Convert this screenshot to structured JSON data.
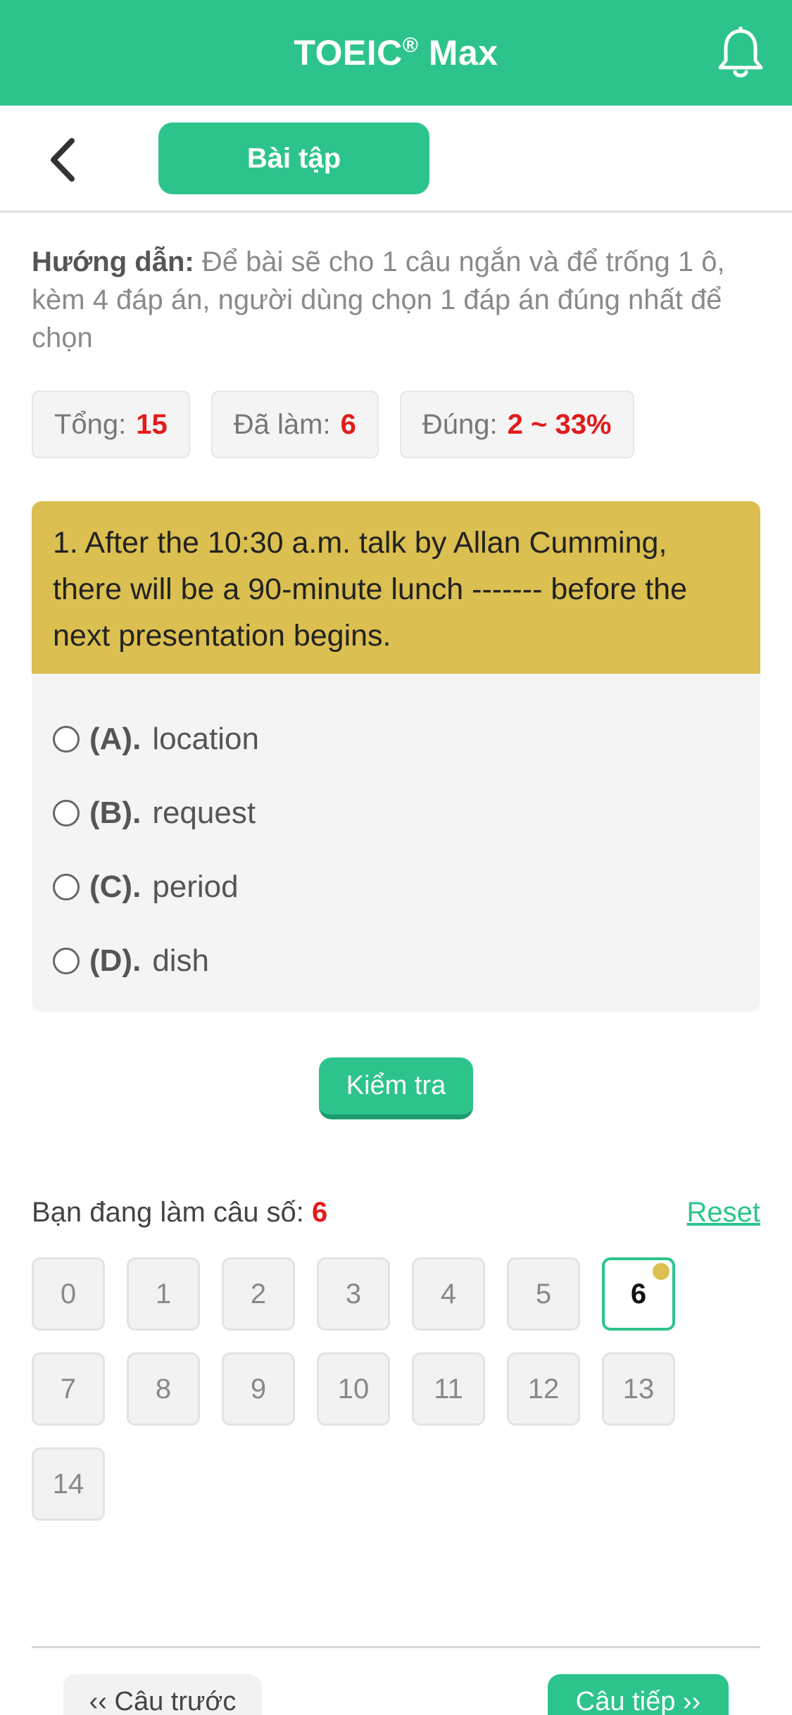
{
  "header": {
    "title": "TOEIC",
    "title_mark": "®",
    "title_suffix": " Max",
    "bell_icon": "bell-icon"
  },
  "subbar": {
    "back_icon": "chevron-left-icon",
    "tab_label": "Bài tập"
  },
  "guide": {
    "label": "Hướng dẫn:",
    "text": " Để bài sẽ cho 1 câu ngắn và để trống 1 ô, kèm 4 đáp án, người dùng chọn 1 đáp án đúng nhất để chọn"
  },
  "stats": {
    "total_label": "Tổng:",
    "total_value": "15",
    "done_label": "Đã làm:",
    "done_value": "6",
    "correct_label": "Đúng:",
    "correct_value": "2 ~ 33%"
  },
  "question": {
    "text": "1. After the 10:30 a.m. talk by Allan Cumming, there will be a 90-minute lunch ------- before the next presentation begins.",
    "options": [
      {
        "letter": "(A).",
        "text": "location"
      },
      {
        "letter": "(B).",
        "text": "request"
      },
      {
        "letter": "(C).",
        "text": "period"
      },
      {
        "letter": "(D).",
        "text": "dish"
      }
    ]
  },
  "check_button": "Kiểm tra",
  "progress": {
    "label": "Bạn đang làm câu số: ",
    "current": "6",
    "reset": "Reset"
  },
  "numbers": [
    "0",
    "1",
    "2",
    "3",
    "4",
    "5",
    "6",
    "7",
    "8",
    "9",
    "10",
    "11",
    "12",
    "13",
    "14"
  ],
  "nav": {
    "prev": "‹‹ Câu trước",
    "next": "Câu tiếp ››"
  },
  "colors": {
    "accent": "#2dc48b",
    "question_bg": "#dbbf50",
    "highlight": "#e31b1b"
  }
}
